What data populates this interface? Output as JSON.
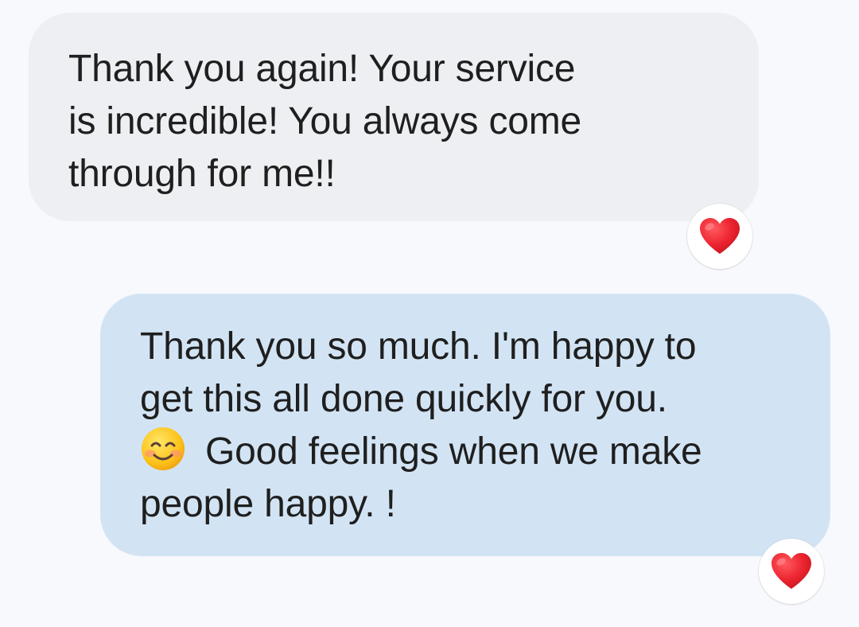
{
  "messages": [
    {
      "direction": "incoming",
      "lines": [
        "Thank you again! Your service",
        "is incredible! You always come",
        "through for me!!"
      ],
      "reaction": {
        "icon": "red-heart-icon",
        "color": "#e8222b"
      }
    },
    {
      "direction": "outgoing",
      "lines": [
        "Thank you so much. I'm happy to",
        "get this all done quickly for you.",
        "Good feelings when we make",
        "people happy. !"
      ],
      "inline_emoji": "smiling-face-with-smiling-eyes-icon",
      "reaction": {
        "icon": "red-heart-icon",
        "color": "#e8222b"
      }
    }
  ],
  "colors": {
    "background": "#f8f9fd",
    "incoming_bubble": "#eeeff2",
    "outgoing_bubble": "#d2e4f4",
    "text": "#1f1f1f"
  }
}
